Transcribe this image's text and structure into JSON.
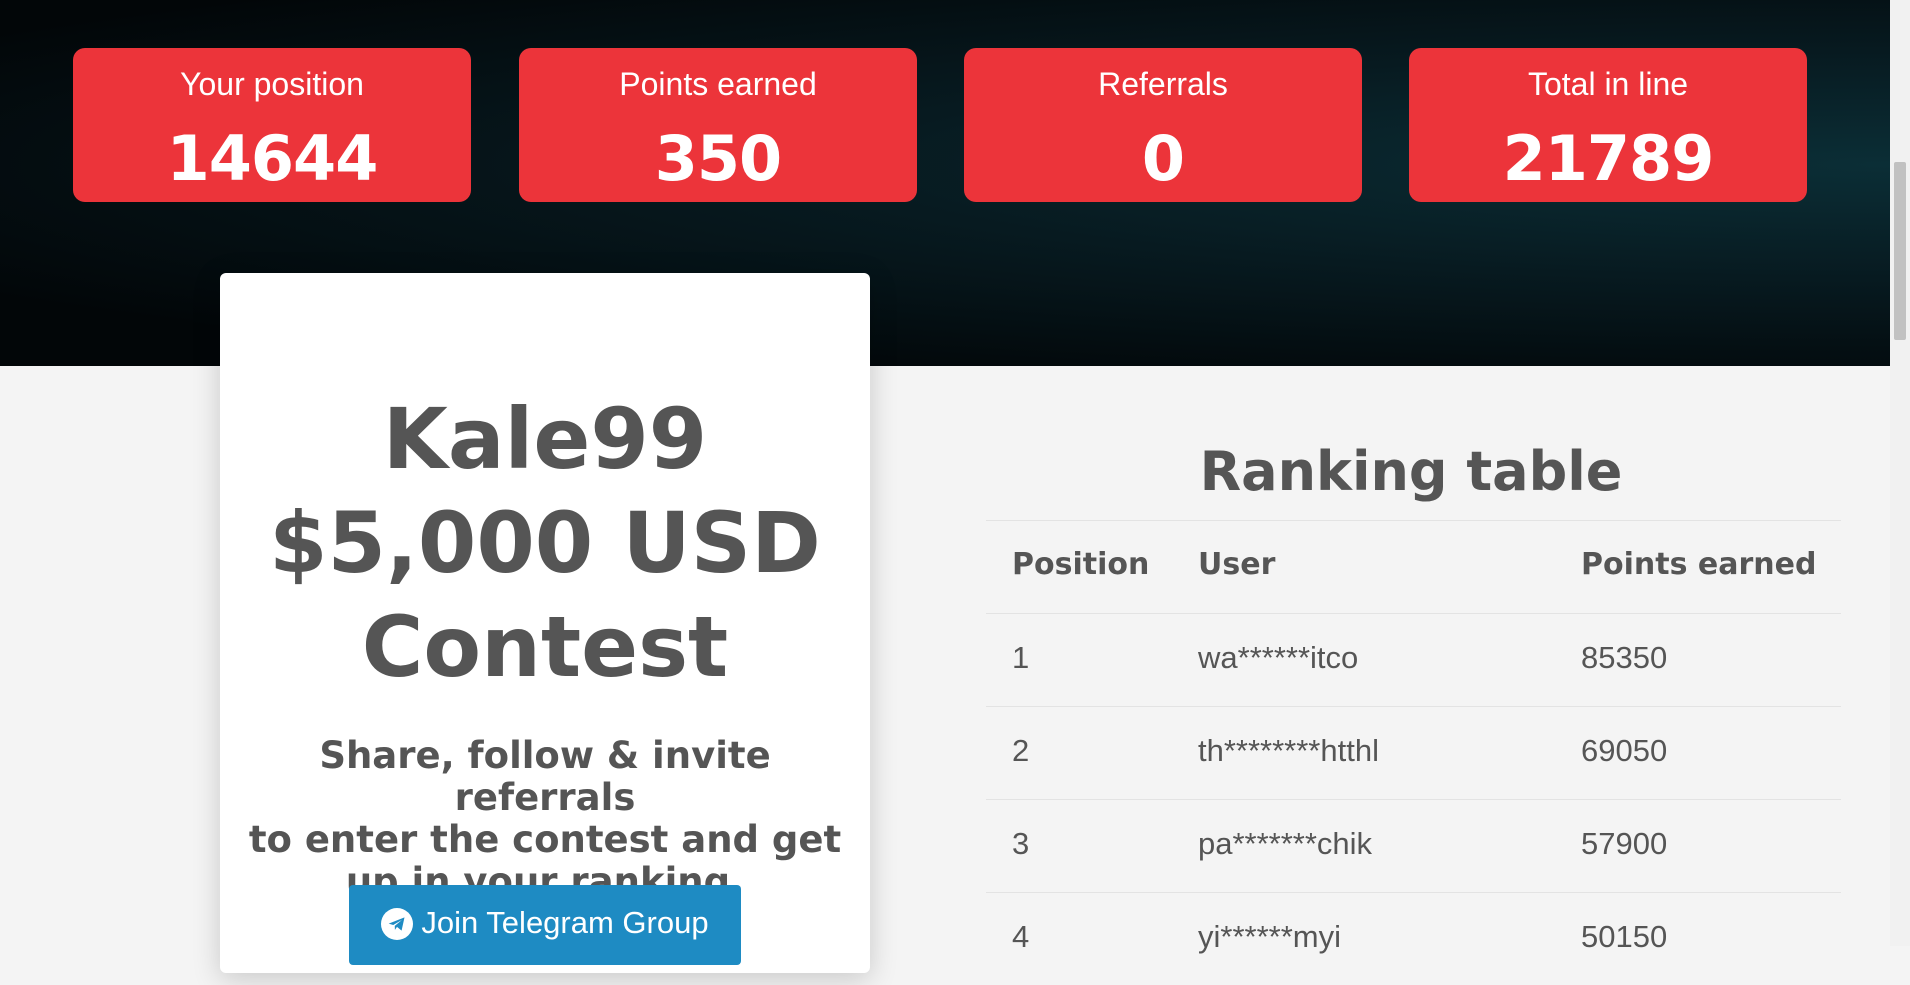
{
  "stats": [
    {
      "label": "Your position",
      "value": "14644"
    },
    {
      "label": "Points earned",
      "value": "350"
    },
    {
      "label": "Referrals",
      "value": "0"
    },
    {
      "label": "Total in line",
      "value": "21789"
    }
  ],
  "card": {
    "title_line1": "Kale99",
    "title_line2": "$5,000 USD",
    "title_line3": "Contest",
    "subtitle_line1": "Share, follow & invite referrals",
    "subtitle_line2": "to enter the contest and get",
    "subtitle_line3": "up in your ranking.",
    "telegram_button": "Join Telegram Group",
    "telegram_icon": "telegram-icon"
  },
  "ranking": {
    "title": "Ranking table",
    "headers": [
      "Position",
      "User",
      "Points earned"
    ],
    "rows": [
      [
        "1",
        "wa******itco",
        "85350"
      ],
      [
        "2",
        "th********htthl",
        "69050"
      ],
      [
        "3",
        "pa*******chik",
        "57900"
      ],
      [
        "4",
        "yi******myi",
        "50150"
      ]
    ]
  },
  "colors": {
    "stat_bg": "#ec343a",
    "button_bg": "#1e8bc3",
    "hero_bg": "#071a20"
  }
}
